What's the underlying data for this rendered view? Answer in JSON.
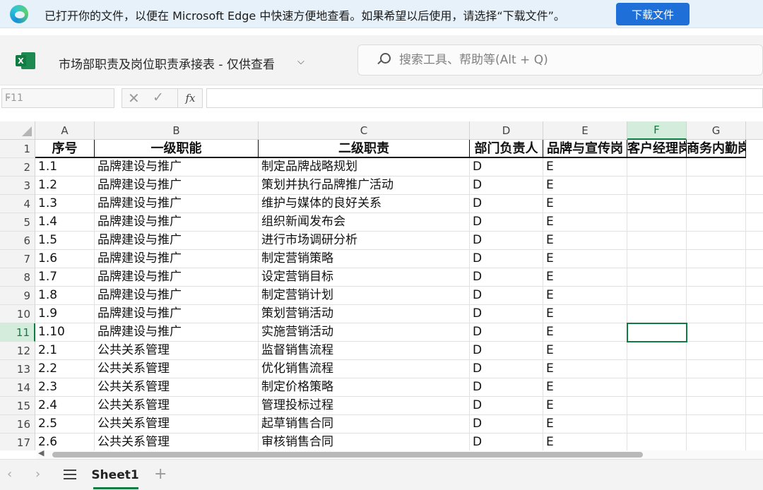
{
  "notification": {
    "message": "已打开你的文件，以便在 Microsoft Edge 中快速方便地查看。如果希望以后使用，请选择“下载文件”。",
    "button": "下载文件"
  },
  "titlebar": {
    "app_badge": "X",
    "doc_title": "市场部职责及岗位职责承接表 - 仅供查看",
    "chevron": "⌵",
    "search_placeholder": "搜索工具、帮助等(Alt + Q)"
  },
  "formula_bar": {
    "name_box": "F11",
    "fx": "fx",
    "formula": ""
  },
  "grid": {
    "columns": [
      "A",
      "B",
      "C",
      "D",
      "E",
      "F",
      "G"
    ],
    "active_column": "F",
    "active_row": "11",
    "header_row": {
      "row_number": "1",
      "cells": [
        "序号",
        "一级职能",
        "二级职责",
        "部门负责人",
        "品牌与宣传岗",
        "客户经理岗",
        "商务内勤岗"
      ]
    },
    "rows": [
      {
        "n": "2",
        "a": "1.1",
        "b": "品牌建设与推广",
        "c": "制定品牌战略规划",
        "d": "D",
        "e": "E"
      },
      {
        "n": "3",
        "a": "1.2",
        "b": "品牌建设与推广",
        "c": "策划并执行品牌推广活动",
        "d": "D",
        "e": "E"
      },
      {
        "n": "4",
        "a": "1.3",
        "b": "品牌建设与推广",
        "c": "维护与媒体的良好关系",
        "d": "D",
        "e": "E"
      },
      {
        "n": "5",
        "a": "1.4",
        "b": "品牌建设与推广",
        "c": "组织新闻发布会",
        "d": "D",
        "e": "E"
      },
      {
        "n": "6",
        "a": "1.5",
        "b": "品牌建设与推广",
        "c": "进行市场调研分析",
        "d": "D",
        "e": "E"
      },
      {
        "n": "7",
        "a": "1.6",
        "b": "品牌建设与推广",
        "c": "制定营销策略",
        "d": "D",
        "e": "E"
      },
      {
        "n": "8",
        "a": "1.7",
        "b": "品牌建设与推广",
        "c": "设定营销目标",
        "d": "D",
        "e": "E"
      },
      {
        "n": "9",
        "a": "1.8",
        "b": "品牌建设与推广",
        "c": "制定营销计划",
        "d": "D",
        "e": "E"
      },
      {
        "n": "10",
        "a": "1.9",
        "b": "品牌建设与推广",
        "c": "策划营销活动",
        "d": "D",
        "e": "E"
      },
      {
        "n": "11",
        "a": "1.10",
        "b": "品牌建设与推广",
        "c": "实施营销活动",
        "d": "D",
        "e": "E"
      },
      {
        "n": "12",
        "a": "2.1",
        "b": "公共关系管理",
        "c": "监督销售流程",
        "d": "D",
        "e": "E"
      },
      {
        "n": "13",
        "a": "2.2",
        "b": "公共关系管理",
        "c": "优化销售流程",
        "d": "D",
        "e": "E"
      },
      {
        "n": "14",
        "a": "2.3",
        "b": "公共关系管理",
        "c": "制定价格策略",
        "d": "D",
        "e": "E"
      },
      {
        "n": "15",
        "a": "2.4",
        "b": "公共关系管理",
        "c": "管理投标过程",
        "d": "D",
        "e": "E"
      },
      {
        "n": "16",
        "a": "2.5",
        "b": "公共关系管理",
        "c": "起草销售合同",
        "d": "D",
        "e": "E"
      },
      {
        "n": "17",
        "a": "2.6",
        "b": "公共关系管理",
        "c": "审核销售合同",
        "d": "D",
        "e": "E"
      }
    ]
  },
  "sheet_tabs": {
    "prev": "‹",
    "next": "›",
    "active_tab": "Sheet1",
    "add": "+"
  },
  "colors": {
    "accent_green": "#107c41",
    "edge_button_blue": "#1f6fd8",
    "notification_bg": "#e6f1fa"
  }
}
